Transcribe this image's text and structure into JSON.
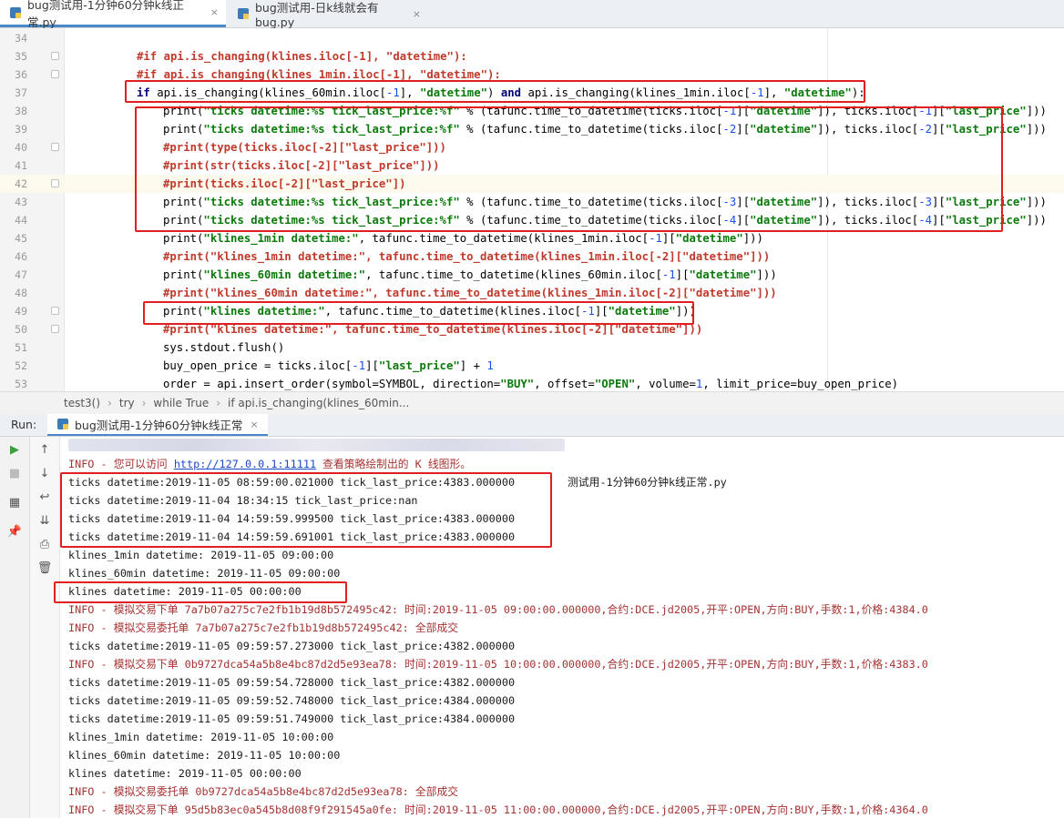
{
  "tabs": [
    {
      "label": "bug测试用-1分钟60分钟k线正常.py",
      "close": "×",
      "active": true
    },
    {
      "label": "bug测试用-日k线就会有bug.py",
      "close": "×",
      "active": false
    }
  ],
  "editor": {
    "lines": [
      {
        "num": "34",
        "text": ""
      },
      {
        "num": "35",
        "text": "#if api.is_changing(klines.iloc[-1], \"datetime\"):"
      },
      {
        "num": "36",
        "text": "#if api.is_changing(klines_1min.iloc[-1], \"datetime\"):"
      },
      {
        "num": "37",
        "text": "if api.is_changing(klines_60min.iloc[-1], \"datetime\") and api.is_changing(klines_1min.iloc[-1], \"datetime\"):"
      },
      {
        "num": "38",
        "text": "print(\"ticks datetime:%s tick_last_price:%f\" % (tafunc.time_to_datetime(ticks.iloc[-1][\"datetime\"]), ticks.iloc[-1][\"last_price\"]))"
      },
      {
        "num": "39",
        "text": "print(\"ticks datetime:%s tick_last_price:%f\" % (tafunc.time_to_datetime(ticks.iloc[-2][\"datetime\"]), ticks.iloc[-2][\"last_price\"]))"
      },
      {
        "num": "40",
        "text": "#print(type(ticks.iloc[-2][\"last_price\"]))"
      },
      {
        "num": "41",
        "text": "#print(str(ticks.iloc[-2][\"last_price\"]))"
      },
      {
        "num": "42",
        "text": "#print(ticks.iloc[-2][\"last_price\"])"
      },
      {
        "num": "43",
        "text": "print(\"ticks datetime:%s tick_last_price:%f\" % (tafunc.time_to_datetime(ticks.iloc[-3][\"datetime\"]), ticks.iloc[-3][\"last_price\"]))"
      },
      {
        "num": "44",
        "text": "print(\"ticks datetime:%s tick_last_price:%f\" % (tafunc.time_to_datetime(ticks.iloc[-4][\"datetime\"]), ticks.iloc[-4][\"last_price\"]))"
      },
      {
        "num": "45",
        "text": "print(\"klines_1min datetime:\", tafunc.time_to_datetime(klines_1min.iloc[-1][\"datetime\"]))"
      },
      {
        "num": "46",
        "text": "#print(\"klines_1min datetime:\", tafunc.time_to_datetime(klines_1min.iloc[-2][\"datetime\"]))"
      },
      {
        "num": "47",
        "text": "print(\"klines_60min datetime:\", tafunc.time_to_datetime(klines_60min.iloc[-1][\"datetime\"]))"
      },
      {
        "num": "48",
        "text": "#print(\"klines_60min datetime:\", tafunc.time_to_datetime(klines_1min.iloc[-2][\"datetime\"]))"
      },
      {
        "num": "49",
        "text": "print(\"klines datetime:\", tafunc.time_to_datetime(klines.iloc[-1][\"datetime\"]))"
      },
      {
        "num": "50",
        "text": "#print(\"klines datetime:\", tafunc.time_to_datetime(klines.iloc[-2][\"datetime\"]))"
      },
      {
        "num": "51",
        "text": "sys.stdout.flush()"
      },
      {
        "num": "52",
        "text": "buy_open_price = ticks.iloc[-1][\"last_price\"] + 1"
      },
      {
        "num": "53",
        "text": "order = api.insert_order(symbol=SYMBOL, direction=\"BUY\", offset=\"OPEN\", volume=1, limit_price=buy_open_price)"
      }
    ]
  },
  "breadcrumb": [
    "test3()",
    "try",
    "while True",
    "if api.is_changing(klines_60min..."
  ],
  "run": {
    "label": "Run:",
    "tab": "bug测试用-1分钟60分钟k线正常"
  },
  "console": {
    "path_tail": "测试用-1分钟60分钟k线正常.py",
    "info_prefix": "INFO - 您可以访问 ",
    "info_link": "http://127.0.0.1:11111",
    "info_suffix": " 查看策略绘制出的 K 线图形。",
    "lines": [
      {
        "text": "ticks datetime:2019-11-05 08:59:00.021000 tick_last_price:4383.000000",
        "info": false
      },
      {
        "text": "ticks datetime:2019-11-04 18:34:15 tick_last_price:nan",
        "info": false
      },
      {
        "text": "ticks datetime:2019-11-04 14:59:59.999500 tick_last_price:4383.000000",
        "info": false
      },
      {
        "text": "ticks datetime:2019-11-04 14:59:59.691001 tick_last_price:4383.000000",
        "info": false
      },
      {
        "text": "klines_1min datetime: 2019-11-05 09:00:00",
        "info": false
      },
      {
        "text": "klines_60min datetime: 2019-11-05 09:00:00",
        "info": false
      },
      {
        "text": "klines datetime: 2019-11-05 00:00:00",
        "info": false
      },
      {
        "text": "INFO - 模拟交易下单 7a7b07a275c7e2fb1b19d8b572495c42: 时间:2019-11-05 09:00:00.000000,合约:DCE.jd2005,开平:OPEN,方向:BUY,手数:1,价格:4384.0",
        "info": true
      },
      {
        "text": "INFO - 模拟交易委托单 7a7b07a275c7e2fb1b19d8b572495c42: 全部成交",
        "info": true
      },
      {
        "text": "ticks datetime:2019-11-05 09:59:57.273000 tick_last_price:4382.000000",
        "info": false
      },
      {
        "text": "INFO - 模拟交易下单 0b9727dca54a5b8e4bc87d2d5e93ea78: 时间:2019-11-05 10:00:00.000000,合约:DCE.jd2005,开平:OPEN,方向:BUY,手数:1,价格:4383.0",
        "info": true
      },
      {
        "text": "ticks datetime:2019-11-05 09:59:54.728000 tick_last_price:4382.000000",
        "info": false
      },
      {
        "text": "ticks datetime:2019-11-05 09:59:52.748000 tick_last_price:4384.000000",
        "info": false
      },
      {
        "text": "ticks datetime:2019-11-05 09:59:51.749000 tick_last_price:4384.000000",
        "info": false
      },
      {
        "text": "klines_1min datetime: 2019-11-05 10:00:00",
        "info": false
      },
      {
        "text": "klines_60min datetime: 2019-11-05 10:00:00",
        "info": false
      },
      {
        "text": "klines datetime: 2019-11-05 00:00:00",
        "info": false
      },
      {
        "text": "INFO - 模拟交易委托单 0b9727dca54a5b8e4bc87d2d5e93ea78: 全部成交",
        "info": true
      },
      {
        "text": "INFO - 模拟交易下单 95d5b83ec0a545b8d08f9f291545a0fe: 时间:2019-11-05 11:00:00.000000,合约:DCE.jd2005,开平:OPEN,方向:BUY,手数:1,价格:4364.0",
        "info": true
      }
    ]
  },
  "colors": {
    "highlight_box": "#e02020",
    "comment": "#c0392b",
    "string": "#0a7a0a",
    "info_text": "#a63232",
    "link": "#1d49c8",
    "accent": "#4a88c7"
  },
  "icons": [
    "python-file-icon",
    "run-icon",
    "stop-icon",
    "up-arrow-icon",
    "down-arrow-icon",
    "soft-wrap-icon",
    "scroll-end-icon",
    "layout-icon",
    "pin-icon",
    "print-icon",
    "trash-icon"
  ]
}
